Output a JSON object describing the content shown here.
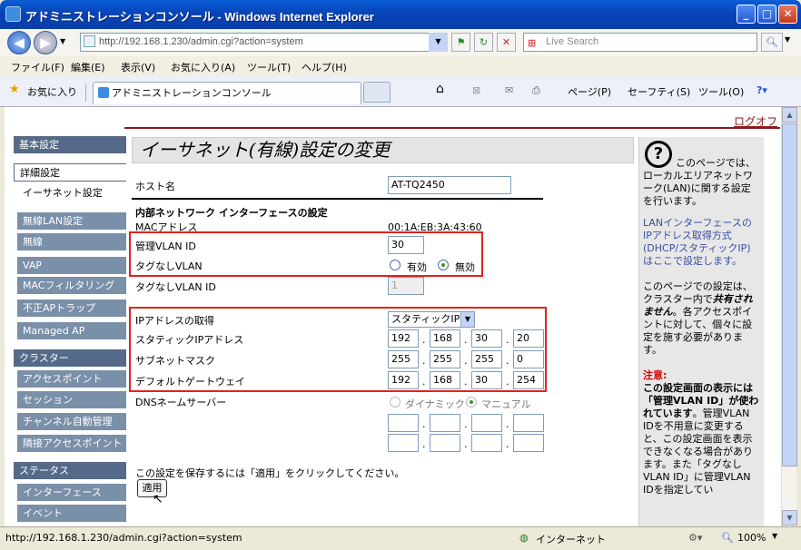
{
  "window": {
    "title": "アドミニストレーションコンソール - Windows Internet Explorer"
  },
  "nav": {
    "address": "http://192.168.1.230/admin.cgi?action=system",
    "search_placeholder": "Live Search"
  },
  "menu": [
    "ファイル(F)",
    "編集(E)",
    "表示(V)",
    "お気に入り(A)",
    "ツール(T)",
    "ヘルプ(H)"
  ],
  "favorites": {
    "label": "お気に入り",
    "tab_title": "アドミニストレーションコンソール",
    "page_menu": "ページ(P)",
    "safety_menu": "セーフティ(S)",
    "tools_menu": "ツール(O)"
  },
  "page": {
    "logoff": "ログオフ",
    "heading": "イーサネット(有線)設定の変更",
    "sidebar": [
      {
        "label": "基本設定",
        "type": "sec"
      },
      {
        "label": "詳細設定",
        "type": "active"
      },
      {
        "label": "イーサネット設定",
        "type": "selected"
      },
      {
        "label": "無線LAN設定",
        "type": "sub"
      },
      {
        "label": "無線",
        "type": "sub"
      },
      {
        "label": "VAP",
        "type": "sub"
      },
      {
        "label": "MACフィルタリング",
        "type": "sub"
      },
      {
        "label": "不正APトラップ",
        "type": "sub"
      },
      {
        "label": "Managed AP",
        "type": "sub"
      },
      {
        "label": "クラスター",
        "type": "sec"
      },
      {
        "label": "アクセスポイント",
        "type": "sub"
      },
      {
        "label": "セッション",
        "type": "sub"
      },
      {
        "label": "チャンネル自動管理",
        "type": "sub"
      },
      {
        "label": "隣接アクセスポイント",
        "type": "sub"
      },
      {
        "label": "ステータス",
        "type": "sec"
      },
      {
        "label": "インターフェース",
        "type": "sub"
      },
      {
        "label": "イベント",
        "type": "sub"
      }
    ],
    "form": {
      "hostname_label": "ホスト名",
      "hostname_value": "AT-TQ2450",
      "internal_section": "内部ネットワーク インターフェースの設定",
      "mac_label": "MACアドレス",
      "mac_value": "00:1A:EB:3A:43:60",
      "mgmt_vlan_label": "管理VLAN ID",
      "mgmt_vlan_value": "30",
      "untagged_label": "タグなしVLAN",
      "untagged_on": "有効",
      "untagged_off": "無効",
      "untagged_id_label": "タグなしVLAN ID",
      "untagged_id_value": "1",
      "ip_mode_label": "IPアドレスの取得",
      "ip_mode_value": "スタティックIP",
      "static_ip_label": "スタティックIPアドレス",
      "static_ip": [
        "192",
        "168",
        "30",
        "20"
      ],
      "subnet_label": "サブネットマスク",
      "subnet": [
        "255",
        "255",
        "255",
        "0"
      ],
      "gateway_label": "デフォルトゲートウェイ",
      "gateway": [
        "192",
        "168",
        "30",
        "254"
      ],
      "dns_label": "DNSネームサーバー",
      "dns_dynamic": "ダイナミック",
      "dns_manual": "マニュアル",
      "save_hint": "この設定を保存するには「適用」をクリックしてください。",
      "apply": "適用"
    },
    "help": {
      "intro": "このページでは、ローカルエリアネットワーク(LAN)に関する設定を行います。",
      "lan_note": "LANインターフェースのIPアドレス取得方式(DHCP/スタティックIP)はここで設定します。",
      "cluster_a": "このページでの設定は、クラスター内で",
      "cluster_b": "共有されません",
      "cluster_c": "。各アクセスポイントに対して、個々に設定を施す必要があります。",
      "caution_title": "注意:",
      "caution_bold": "この設定画面の表示には「管理VLAN ID」が使われています",
      "caution_text": "。管理VLAN IDを不用意に変更すると、この設定画面を表示できなくなる場合があります。また「タグなしVLAN ID」に管理VLAN IDを指定してい"
    }
  },
  "status": {
    "url": "http://192.168.1.230/admin.cgi?action=system",
    "zone": "インターネット",
    "zoom": "100%"
  }
}
